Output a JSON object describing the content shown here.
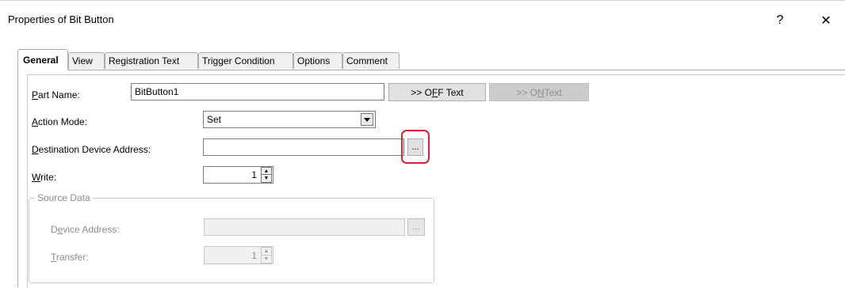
{
  "window": {
    "title": "Properties of Bit Button",
    "help_label": "?",
    "close_label": "✕"
  },
  "tabs": [
    {
      "label": "General",
      "active": true
    },
    {
      "label": "View",
      "active": false
    },
    {
      "label": "Registration Text",
      "active": false
    },
    {
      "label": "Trigger Condition",
      "active": false
    },
    {
      "label": "Options",
      "active": false
    },
    {
      "label": "Comment",
      "active": false
    }
  ],
  "form": {
    "part_name": {
      "label_mnemonic": "P",
      "label_rest": "art Name:",
      "value": "BitButton1"
    },
    "off_text_button": {
      "prefix": ">> O",
      "mnemonic": "F",
      "suffix": "F Text"
    },
    "on_text_button": {
      "prefix": ">> O",
      "mnemonic": "N",
      "suffix": " Text"
    },
    "action_mode": {
      "label_mnemonic": "A",
      "label_rest": "ction Mode:",
      "value": "Set"
    },
    "destination": {
      "label_mnemonic": "D",
      "label_rest": "estination Device Address:",
      "value": "",
      "browse_label": "..."
    },
    "write": {
      "label_mnemonic": "W",
      "label_rest": "rite:",
      "value": "1"
    },
    "source_data": {
      "legend": "Source Data",
      "device_address": {
        "label_prefix": "D",
        "label_mnemonic": "e",
        "label_rest": "vice Address:",
        "value": "",
        "browse_label": "..."
      },
      "transfer": {
        "label_mnemonic": "T",
        "label_rest": "ransfer:",
        "value": "1"
      }
    }
  },
  "colors": {
    "highlight": "#d9232e",
    "disabled_text": "#8c8c8c"
  }
}
